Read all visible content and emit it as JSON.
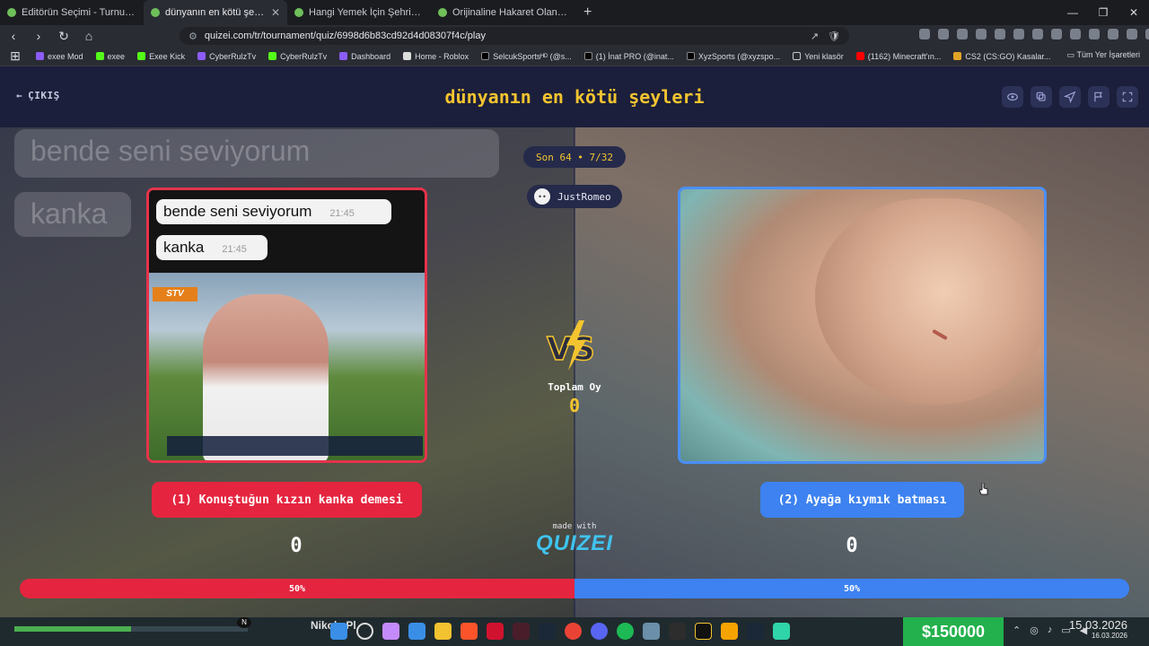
{
  "browser": {
    "tabs": [
      {
        "title": "Editörün Seçimi - Turnuva - Quizei",
        "active": false
      },
      {
        "title": "dünyanın en kötü şeyleri - Tier L",
        "active": true
      },
      {
        "title": "Hangi Yemek İçin Şehrine Gidersin?",
        "active": false
      },
      {
        "title": "Orijinaline Hakaret Olan Yemek - Tier",
        "active": false
      }
    ],
    "url": "quizei.com/tr/tournament/quiz/6998d6b83cd92d4d08307f4c/play",
    "bookmarks": [
      "exee Mod",
      "exee",
      "Exee Kick",
      "CyberRulzTv",
      "CyberRulzTv",
      "Dashboard",
      "Home - Roblox",
      "SelcukSportsᴴᴰ (@s...",
      "(1) İnat PRO (@inat...",
      "XyzSports (@xyzspo...",
      "Yeni klasör",
      "(1162) Minecraft'ın...",
      "CS2 (CS:GO) Kasalar..."
    ],
    "bookmarks_right": "Tüm Yer İşaretleri"
  },
  "page": {
    "exit_label": "ÇIKIŞ",
    "title": "dünyanın en kötü şeyleri",
    "round": "Son 64 • 7/32",
    "username": "JustRomeo",
    "bg_text_1": "bende seni seviyorum",
    "bg_text_2": "kanka",
    "left": {
      "chat_1": "bende seni seviyorum",
      "time_1": "21:45",
      "chat_2": "kanka",
      "time_2": "21:45",
      "tv_logo": "STV",
      "option_label": "(1) Konuştuğun kızın kanka demesi",
      "votes": "0",
      "percent": 0.5,
      "percent_label": "50%"
    },
    "right": {
      "option_label": "(2) Ayağa kıymık batması",
      "votes": "0",
      "percent": 0.5,
      "percent_label": "50%"
    },
    "total_label": "Toplam Oy",
    "total_votes": "0",
    "made_with": "made with",
    "brand": "QUIZEI"
  },
  "taskbar": {
    "user": "Nikola Pl",
    "money": "$150000",
    "time": "15.03.2026",
    "date": "16.03.2026"
  },
  "colors": {
    "accent_yellow": "#f4c430",
    "left_red": "#e5253f",
    "right_blue": "#3d82f0"
  }
}
